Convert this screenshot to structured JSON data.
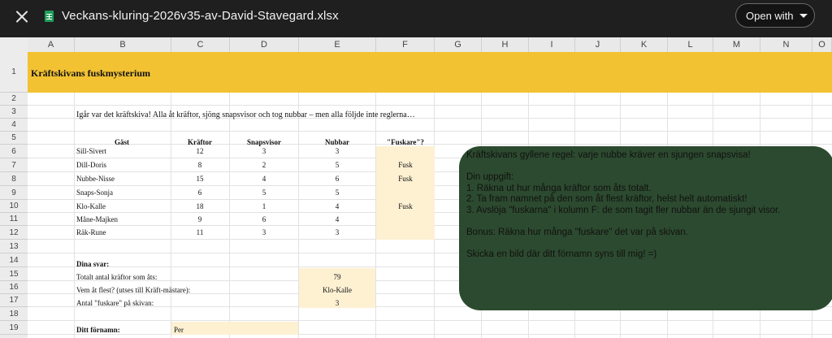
{
  "toolbar": {
    "title": "Veckans-kluring-2026v35-av-David-Stavegard.xlsx",
    "open_with_label": "Open with"
  },
  "columns": [
    "A",
    "B",
    "C",
    "D",
    "E",
    "F",
    "G",
    "H",
    "I",
    "J",
    "K",
    "L",
    "M",
    "N",
    "O"
  ],
  "rows": [
    "1",
    "2",
    "3",
    "4",
    "5",
    "6",
    "7",
    "8",
    "9",
    "10",
    "11",
    "12",
    "13",
    "14",
    "15",
    "16",
    "17",
    "18",
    "19"
  ],
  "sheet": {
    "title": "Kräftskivans fuskmysterium",
    "intro": "Igår var det kräftskiva! Alla åt kräftor, sjöng snapsvisor och tog nubbar – men alla följde inte reglerna…",
    "headers": [
      "Gäst",
      "Kräftor",
      "Snapsvisor",
      "Nubbar",
      "\"Fuskare\"?"
    ],
    "guests": [
      {
        "name": "Sill-Sivert",
        "krafter": "12",
        "visor": "3",
        "nubbar": "3",
        "fusk": ""
      },
      {
        "name": "Dill-Doris",
        "krafter": "8",
        "visor": "2",
        "nubbar": "5",
        "fusk": "Fusk"
      },
      {
        "name": "Nubbe-Nisse",
        "krafter": "15",
        "visor": "4",
        "nubbar": "6",
        "fusk": "Fusk"
      },
      {
        "name": "Snaps-Sonja",
        "krafter": "6",
        "visor": "5",
        "nubbar": "5",
        "fusk": ""
      },
      {
        "name": "Klo-Kalle",
        "krafter": "18",
        "visor": "1",
        "nubbar": "4",
        "fusk": "Fusk"
      },
      {
        "name": "Måne-Majken",
        "krafter": "9",
        "visor": "6",
        "nubbar": "4",
        "fusk": ""
      },
      {
        "name": "Räk-Rune",
        "krafter": "11",
        "visor": "3",
        "nubbar": "3",
        "fusk": ""
      }
    ],
    "answers_heading": "Dina svar:",
    "answers": [
      {
        "label": "Totalt antal kräftor som åts:",
        "value": "79"
      },
      {
        "label": "Vem åt flest? (utses till Kräft-mästare):",
        "value": "Klo-Kalle"
      },
      {
        "label": "Antal \"fuskare\" på skivan:",
        "value": "3"
      }
    ],
    "name_label": "Ditt förnamn:",
    "name_value": "Per"
  },
  "note": {
    "lines": [
      "Kräftskivans gyllene regel: varje nubbe kräver en sjungen snapsvisa!",
      "",
      "Din uppgift:",
      "1.  Räkna ut hur många kräftor som åts totalt.",
      "2.  Ta fram namnet på den som åt flest kräftor, helst helt automatiskt!",
      "3.  Avslöja \"fuskarna\" i kolumn F: de som tagit fler nubbar än de sjungit visor.",
      "",
      "Bonus:  Räkna hur många \"fuskare\" det var på skivan.",
      "",
      "Skicka en bild där ditt förnamn syns till mig!  =)"
    ]
  },
  "colors": {
    "banner": "#f2c232",
    "title_text": "#0f4b2a",
    "highlight_fill": "#fdf1d2",
    "note_fill": "#2c4a2f"
  }
}
